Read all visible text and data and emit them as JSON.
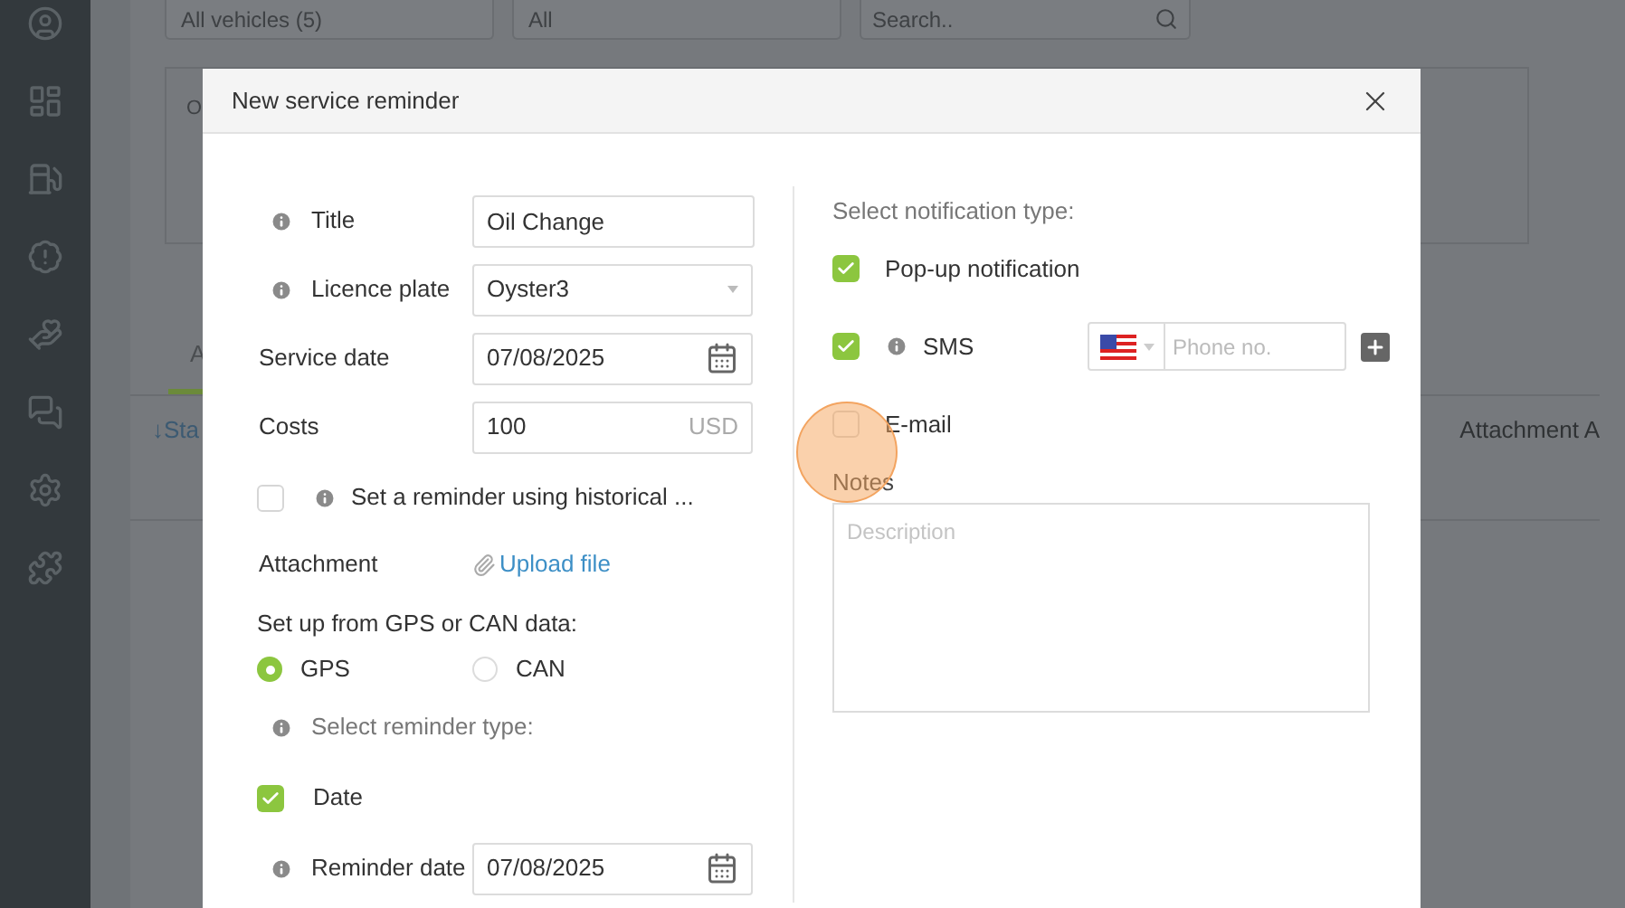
{
  "background": {
    "filters": [
      {
        "value": "All vehicles   (5)"
      },
      {
        "value": "All"
      }
    ],
    "search": {
      "placeholder": "Search.."
    },
    "card": {
      "label": "O"
    },
    "tab": "A",
    "toolbar_link": "↓Sta",
    "column_header": "Attachment A"
  },
  "dialog": {
    "title": "New service reminder",
    "form": [
      {
        "kind": "text",
        "label": "Title",
        "info": true,
        "value": "Oil Change"
      },
      {
        "kind": "select",
        "label": "Licence plate",
        "info": true,
        "value": "Oyster3"
      },
      {
        "kind": "date",
        "label": "Service date",
        "info": false,
        "value": "07/08/2025"
      },
      {
        "kind": "money",
        "label": "Costs",
        "info": false,
        "value": "100",
        "unit": "USD"
      },
      {
        "kind": "checkbox",
        "label": "Set a reminder using historical ...",
        "info": true,
        "checked": false
      },
      {
        "kind": "upload",
        "label": "Attachment",
        "link": "Upload file"
      },
      {
        "kind": "radio",
        "label": "Set up from GPS or CAN data:",
        "options": [
          {
            "label": "GPS",
            "selected": true
          },
          {
            "label": "CAN",
            "selected": false
          }
        ]
      },
      {
        "kind": "heading",
        "label": "Select reminder type:",
        "info": true
      },
      {
        "kind": "checkbox",
        "label": "Date",
        "info": false,
        "checked": true
      },
      {
        "kind": "date",
        "label": "Reminder date",
        "info": true,
        "value": "07/08/2025"
      }
    ],
    "notification_heading": "Select notification type:",
    "notifications": [
      {
        "label": "Pop-up notification",
        "checked": true,
        "info": false
      },
      {
        "label": "SMS",
        "checked": true,
        "info": true,
        "phone_placeholder": "Phone no."
      },
      {
        "label": "E-mail",
        "checked": false,
        "info": false
      }
    ],
    "notes": {
      "label": "Notes",
      "placeholder": "Description"
    }
  }
}
